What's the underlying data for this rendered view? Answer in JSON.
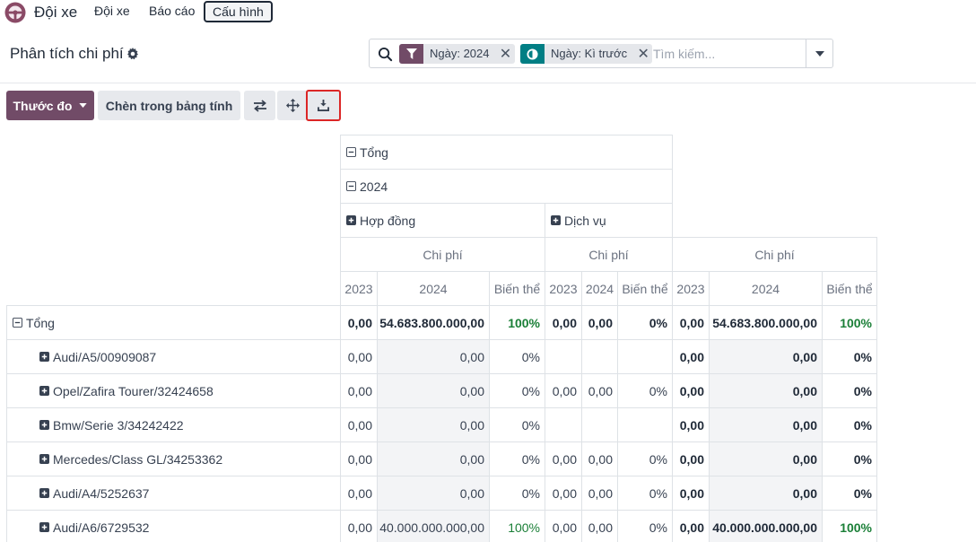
{
  "navbar": {
    "app_name": "Đội xe",
    "items": [
      {
        "label": "Đội xe",
        "active": false
      },
      {
        "label": "Báo cáo",
        "active": false
      },
      {
        "label": "Cấu hình",
        "active": true
      }
    ]
  },
  "control_panel": {
    "title": "Phân tích chi phí",
    "search": {
      "facets": [
        {
          "label": "Ngày: 2024",
          "icon": "filter-icon",
          "color": "#714b67"
        },
        {
          "label": "Ngày: Kì trước",
          "icon": "comparison-icon",
          "color": "#017e84"
        }
      ],
      "placeholder": "Tìm kiếm..."
    }
  },
  "toolbar": {
    "measures_label": "Thước đo",
    "insert_label": "Chèn trong bảng tính"
  },
  "pivot": {
    "col_total": "Tổng",
    "col_year": "2024",
    "groups": [
      {
        "label": "Hợp đồng"
      },
      {
        "label": "Dịch vụ"
      }
    ],
    "measure": "Chi phí",
    "sub_headers": [
      "2023",
      "2024",
      "Biến thể"
    ],
    "rows": [
      {
        "label": "Tổng",
        "total": true,
        "values": [
          "0,00",
          "54.683.800.000,00",
          "100%",
          "0,00",
          "0,00",
          "0%",
          "0,00",
          "54.683.800.000,00",
          "100%"
        ]
      },
      {
        "label": "Audi/A5/00909087",
        "values": [
          "0,00",
          "0,00",
          "0%",
          "",
          "",
          "",
          "0,00",
          "0,00",
          "0%"
        ]
      },
      {
        "label": "Opel/Zafira Tourer/32424658",
        "values": [
          "0,00",
          "0,00",
          "0%",
          "0,00",
          "0,00",
          "0%",
          "0,00",
          "0,00",
          "0%"
        ]
      },
      {
        "label": "Bmw/Serie 3/34242422",
        "values": [
          "0,00",
          "0,00",
          "0%",
          "",
          "",
          "",
          "0,00",
          "0,00",
          "0%"
        ]
      },
      {
        "label": "Mercedes/Class GL/34253362",
        "values": [
          "0,00",
          "0,00",
          "0%",
          "0,00",
          "0,00",
          "0%",
          "0,00",
          "0,00",
          "0%"
        ]
      },
      {
        "label": "Audi/A4/5252637",
        "values": [
          "0,00",
          "0,00",
          "0%",
          "0,00",
          "0,00",
          "0%",
          "0,00",
          "0,00",
          "0%"
        ]
      },
      {
        "label": "Audi/A6/6729532",
        "values": [
          "0,00",
          "40.000.000.000,00",
          "100%",
          "0,00",
          "0,00",
          "0%",
          "0,00",
          "40.000.000.000,00",
          "100%"
        ]
      }
    ]
  }
}
